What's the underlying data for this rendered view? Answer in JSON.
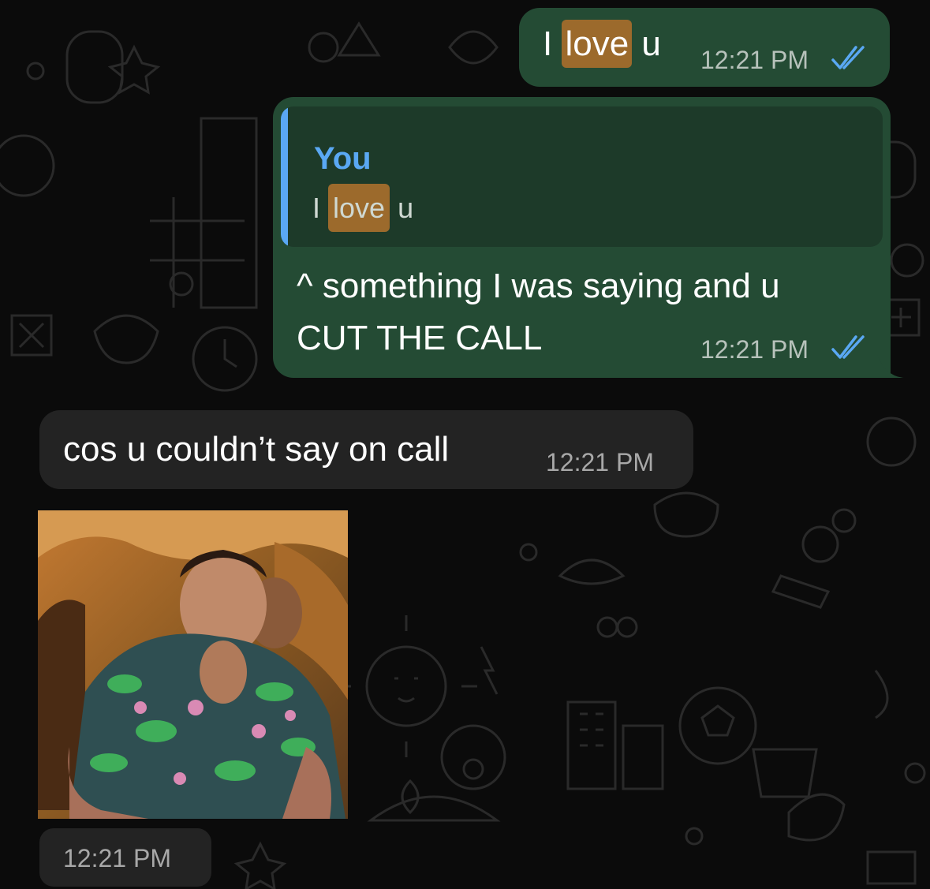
{
  "messages": [
    {
      "id": "m1",
      "direction": "outgoing",
      "text_before": "I",
      "text_highlight": "love",
      "text_after": "u",
      "time": "12:21 PM",
      "status": "read"
    },
    {
      "id": "m2",
      "direction": "outgoing",
      "quote_author": "You",
      "quote_before": "I",
      "quote_highlight": "love",
      "quote_after": "u",
      "line1": "^ something I was saying and u",
      "line2": "CUT THE CALL",
      "time": "12:21 PM",
      "status": "read"
    },
    {
      "id": "m3",
      "direction": "incoming",
      "text": "cos u couldn’t say on call",
      "time": "12:21 PM"
    },
    {
      "id": "m4",
      "direction": "incoming",
      "media": "gif",
      "time": "12:21 PM"
    }
  ],
  "colors": {
    "background": "#0b0b0b",
    "outgoing_bubble": "#244b34",
    "incoming_bubble": "#232323",
    "quote_accent": "#5aa8f3",
    "highlight": "#9c6a2c",
    "read_ticks": "#5aa8f3"
  },
  "icons": {
    "read_receipt": "double-check-icon"
  }
}
